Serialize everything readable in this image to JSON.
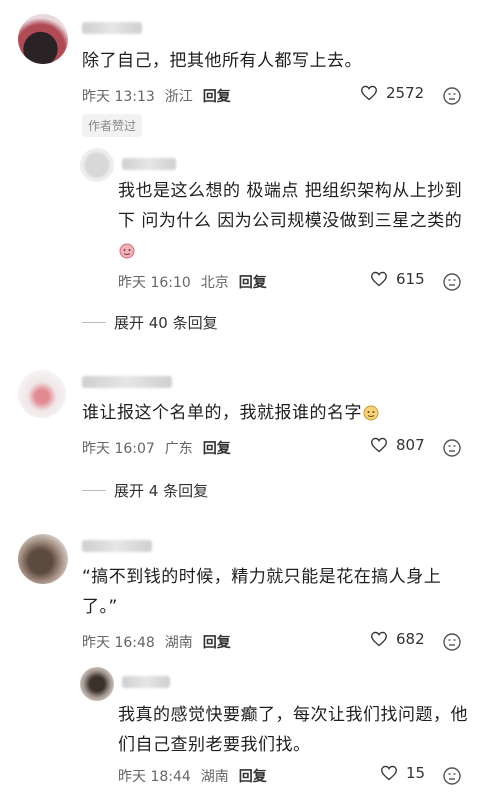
{
  "comments": [
    {
      "text": "除了自己，把其他所有人都写上去。",
      "time": "昨天 13:13",
      "location": "浙江",
      "reply": "回复",
      "likes": "2572",
      "badge": "作者赞过"
    },
    {
      "text": "我也是这么想的 极端点 把组织架构从上抄到下 问为什么 因为公司规模没做到三星之类的",
      "time": "昨天 16:10",
      "location": "北京",
      "reply": "回复",
      "likes": "615"
    },
    {
      "text": "谁让报这个名单的，我就报谁的名字",
      "time": "昨天 16:07",
      "location": "广东",
      "reply": "回复",
      "likes": "807"
    },
    {
      "text": "“搞不到钱的时候，精力就只能是花在搞人身上了。”",
      "time": "昨天 16:48",
      "location": "湖南",
      "reply": "回复",
      "likes": "682"
    },
    {
      "text": "我真的感觉快要癫了，每次让我们找问题，他们自己查别老要我们找。",
      "time": "昨天 18:44",
      "location": "湖南",
      "reply": "回复",
      "likes": "15"
    }
  ],
  "expand": [
    {
      "label": "展开 40 条回复"
    },
    {
      "label": "展开 4 条回复"
    }
  ],
  "icons": {
    "like": "heart-outline-icon",
    "dislike": "dislike-face-icon",
    "emoji": "emoji-icon"
  }
}
